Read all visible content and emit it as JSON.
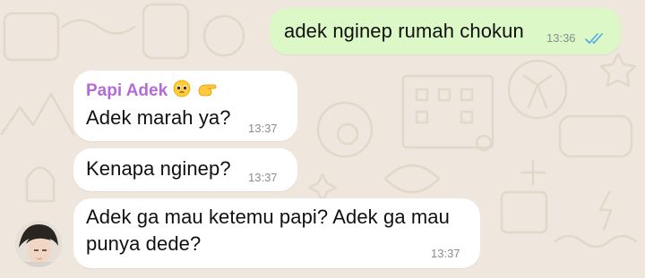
{
  "colors": {
    "wallpaper": "#efe7dd",
    "outgoing_bubble": "#dcf8c6",
    "incoming_bubble": "#ffffff",
    "sender_name": "#b36bd6",
    "read_ticks": "#4fa6e8",
    "timestamp": "#8c8c8c"
  },
  "messages": [
    {
      "direction": "outgoing",
      "text": "adek nginep rumah chokun",
      "time": "13:36",
      "status_icon": "double-check-read-icon"
    },
    {
      "direction": "incoming",
      "sender": "Papi Adek",
      "sender_emojis": [
        "pleading-face-emoji",
        "pinching-hand-emoji"
      ],
      "text": "Adek marah ya?",
      "time": "13:37"
    },
    {
      "direction": "incoming",
      "text": "Kenapa nginep?",
      "time": "13:37"
    },
    {
      "direction": "incoming",
      "text_lines": [
        "Adek ga mau ketemu papi? Adek ga mau",
        "punya dede?"
      ],
      "time": "13:37",
      "avatar_icon": "contact-avatar-photo"
    }
  ]
}
